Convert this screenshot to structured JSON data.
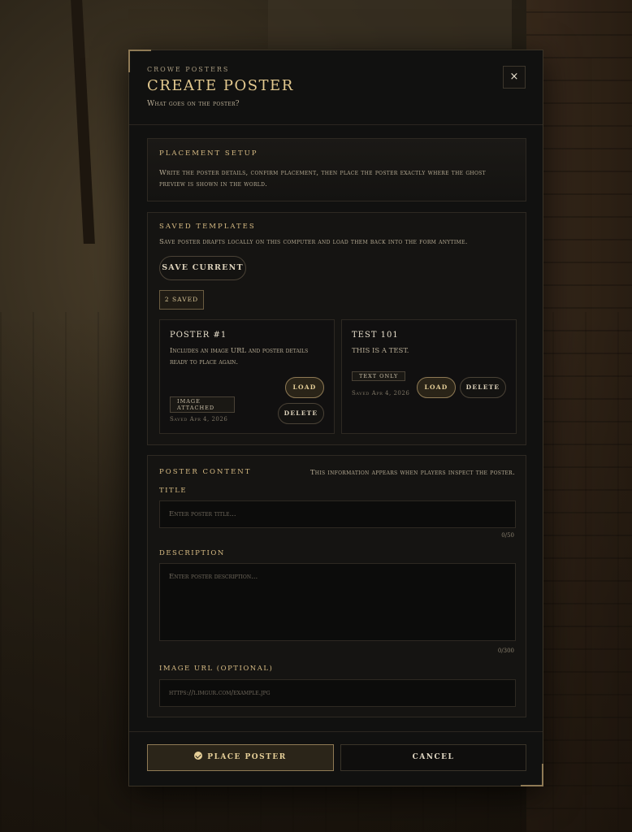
{
  "window": {
    "kicker": "CROWE POSTERS",
    "title": "CREATE POSTER",
    "subtitle": "What goes on the poster?",
    "close_label": "×"
  },
  "placement": {
    "heading": "PLACEMENT SETUP",
    "text": "Write the poster details, confirm placement, then place the poster exactly where the ghost preview is shown in the world."
  },
  "templates": {
    "heading": "SAVED TEMPLATES",
    "text": "Save poster drafts locally on this computer and load them back into the form anytime.",
    "save_current_label": "SAVE CURRENT",
    "count_label": "2 SAVED",
    "items": [
      {
        "title": "POSTER #1",
        "description": "Includes an image URL and poster details ready to place again.",
        "tag": "IMAGE ATTACHED",
        "saved": "Saved Apr 4, 2026",
        "load_label": "LOAD",
        "delete_label": "DELETE"
      },
      {
        "title": "TEST 101",
        "description": "THIS IS A TEST.",
        "tag": "TEXT ONLY",
        "saved": "Saved Apr 4, 2026",
        "load_label": "LOAD",
        "delete_label": "DELETE"
      }
    ]
  },
  "content": {
    "heading": "POSTER CONTENT",
    "note": "This information appears when players inspect the poster.",
    "title_label": "TITLE",
    "title_placeholder": "Enter poster title...",
    "title_value": "",
    "title_counter": "0/50",
    "description_label": "DESCRIPTION",
    "description_placeholder": "Enter poster description...",
    "description_value": "",
    "description_counter": "0/300",
    "image_label": "IMAGE URL (OPTIONAL)",
    "image_placeholder": "https://i.imgur.com/example.jpg",
    "image_value": ""
  },
  "footer": {
    "place_label": "PLACE POSTER",
    "cancel_label": "CANCEL"
  },
  "colors": {
    "accent": "#e3c98f",
    "panel": "#111110",
    "border": "#8f7a55"
  },
  "icons": {
    "place": "check-circle-icon",
    "close": "close-icon"
  }
}
